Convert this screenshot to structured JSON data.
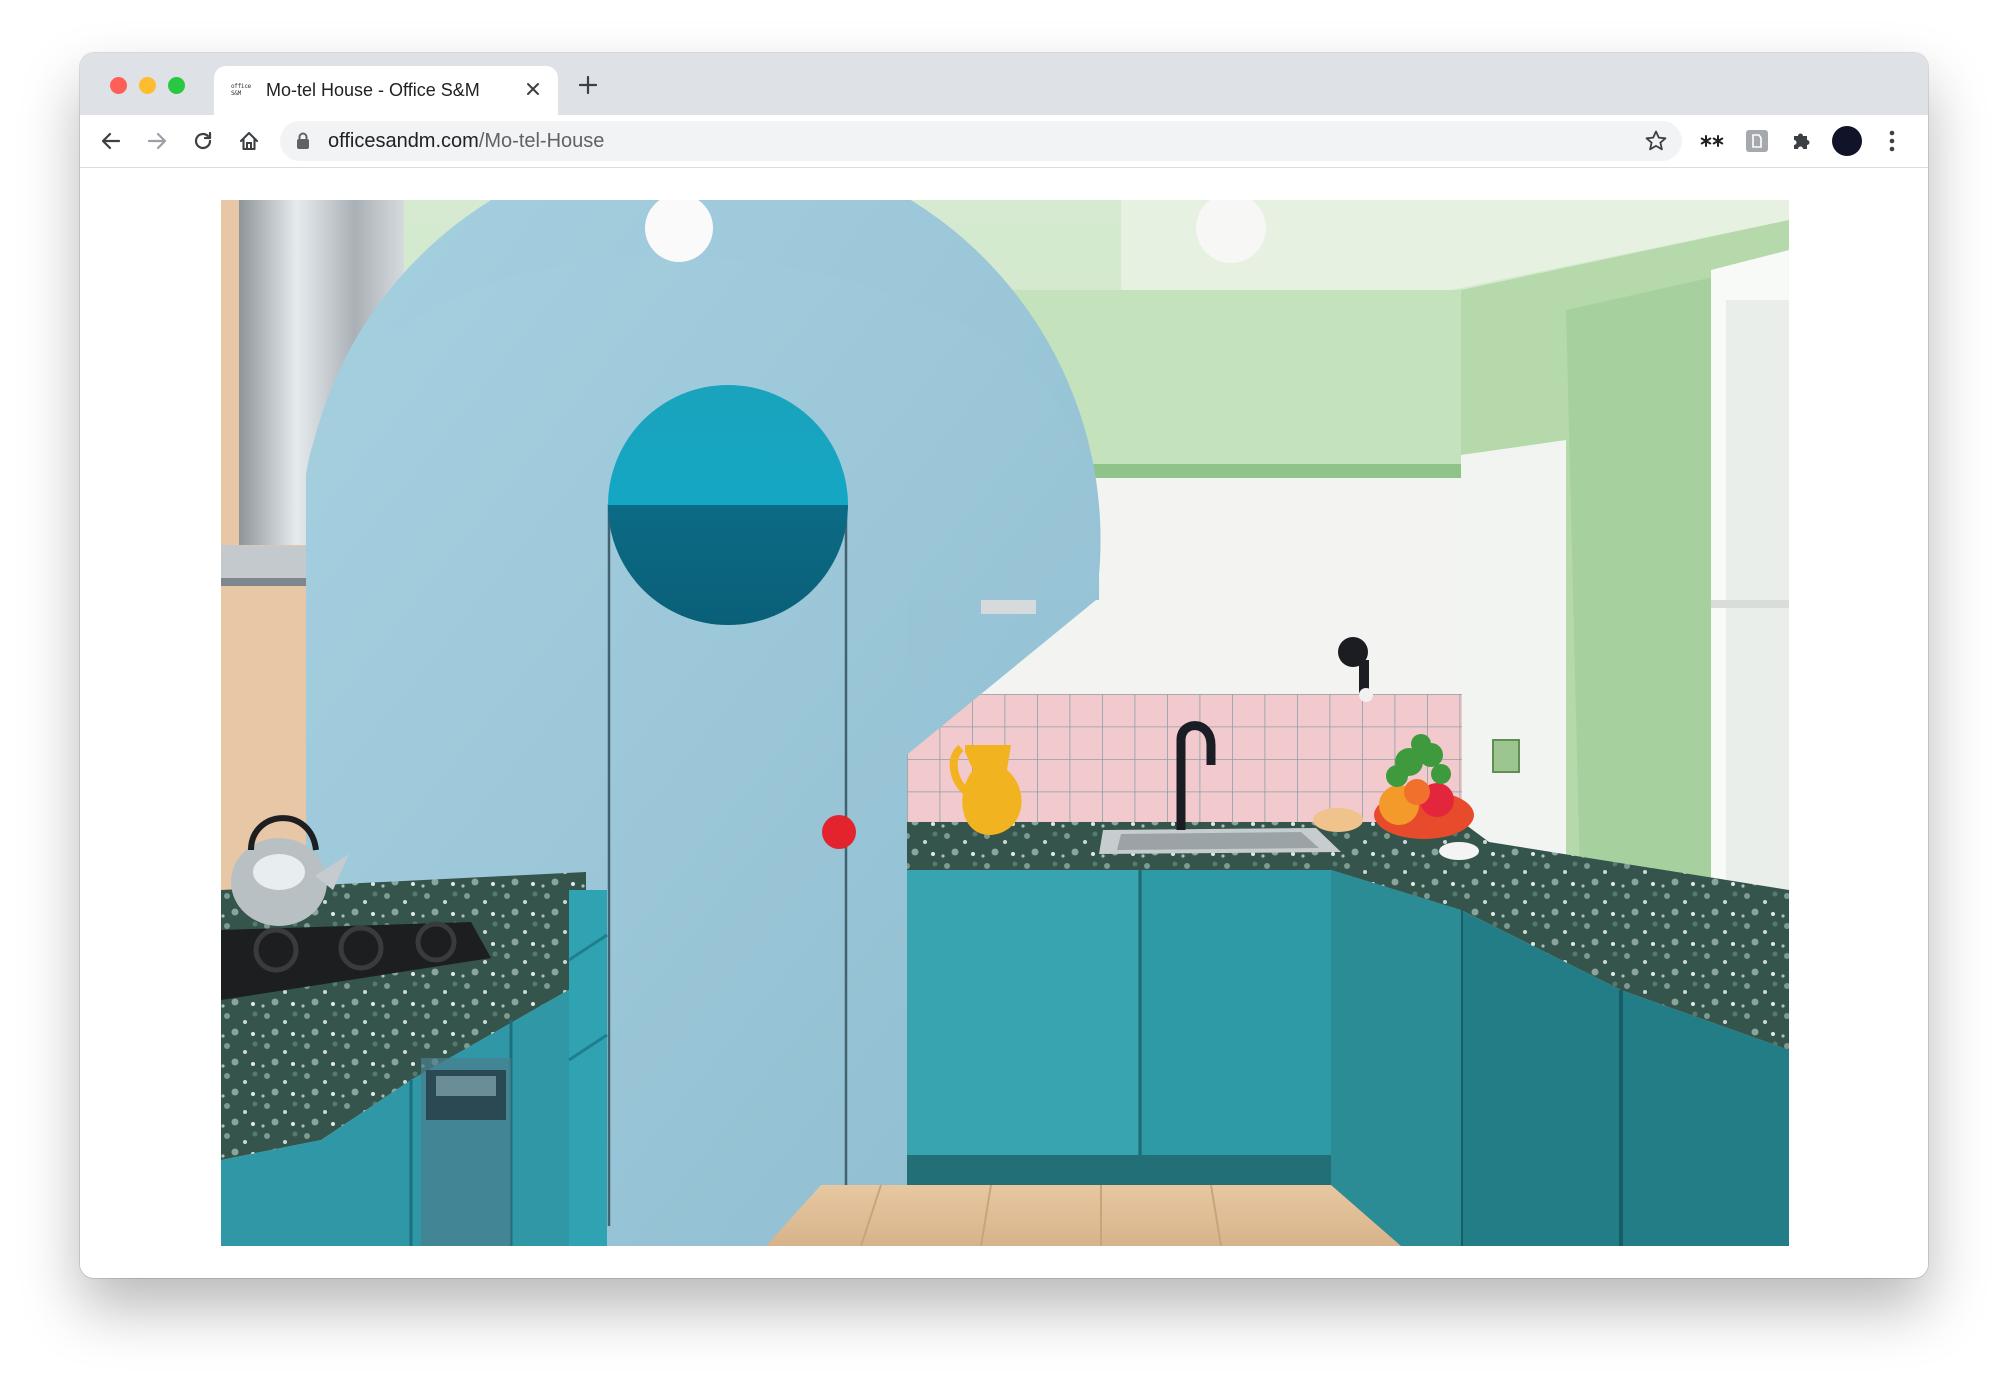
{
  "browser": {
    "tab": {
      "favicon_text": "office S&M",
      "title": "Mo-tel House - Office S&M",
      "close_icon": "close-icon"
    },
    "new_tab_icon": "plus-icon",
    "toolbar": {
      "back_icon": "arrow-left-icon",
      "forward_icon": "arrow-right-icon",
      "reload_icon": "reload-icon",
      "home_icon": "home-icon",
      "bookmark_icon": "star-icon",
      "extension_1": "asterisks-icon",
      "extension_2": "grey-square-extension-icon",
      "extensions_icon": "puzzle-icon",
      "menu_icon": "kebab-menu-icon"
    },
    "address": {
      "domain": "officesandm.com",
      "path": "/Mo-tel-House"
    }
  },
  "content": {
    "image_subject": "kitchen-photo"
  },
  "colors": {
    "tab_strip": "#dee1e6",
    "close_red": "#fe5f57",
    "minimize_yellow": "#febc2e",
    "zoom_green": "#28c840",
    "cabinet_teal": "#2a8c95",
    "arch_blue": "#9fcbdd",
    "wall_green": "#b8dcb0"
  }
}
